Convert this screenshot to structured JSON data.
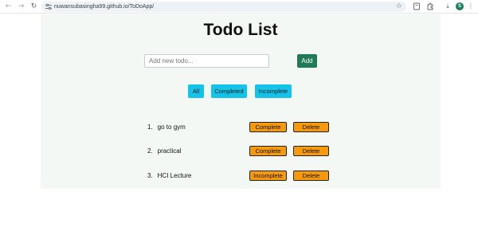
{
  "browser": {
    "url": "nuwansubasingha99.github.io/ToDoApp/",
    "nav_back_icon": "←",
    "nav_forward_icon": "→",
    "reload_icon": "↻",
    "star_icon": "☆",
    "download_icon": "⤓",
    "menu_icon": "⋮",
    "avatar_initial": "S",
    "accent": "#1e7d5f"
  },
  "app": {
    "title": "Todo List",
    "input_placeholder": "Add new todo...",
    "add_label": "Add",
    "filters": [
      "All",
      "Completed",
      "Incomplete"
    ],
    "todos": [
      {
        "number": "1.",
        "text": "go to gym",
        "status_label": "Complete",
        "delete_label": "Delete"
      },
      {
        "number": "2.",
        "text": "practical",
        "status_label": "Complete",
        "delete_label": "Delete"
      },
      {
        "number": "3.",
        "text": "HCI Lecture",
        "status_label": "Incomplete",
        "delete_label": "Delete"
      }
    ],
    "colors": {
      "background": "#f3f8f5",
      "add_button": "#1f7a55",
      "filter_button": "#13c3e8",
      "action_button": "#f69a0c"
    }
  }
}
